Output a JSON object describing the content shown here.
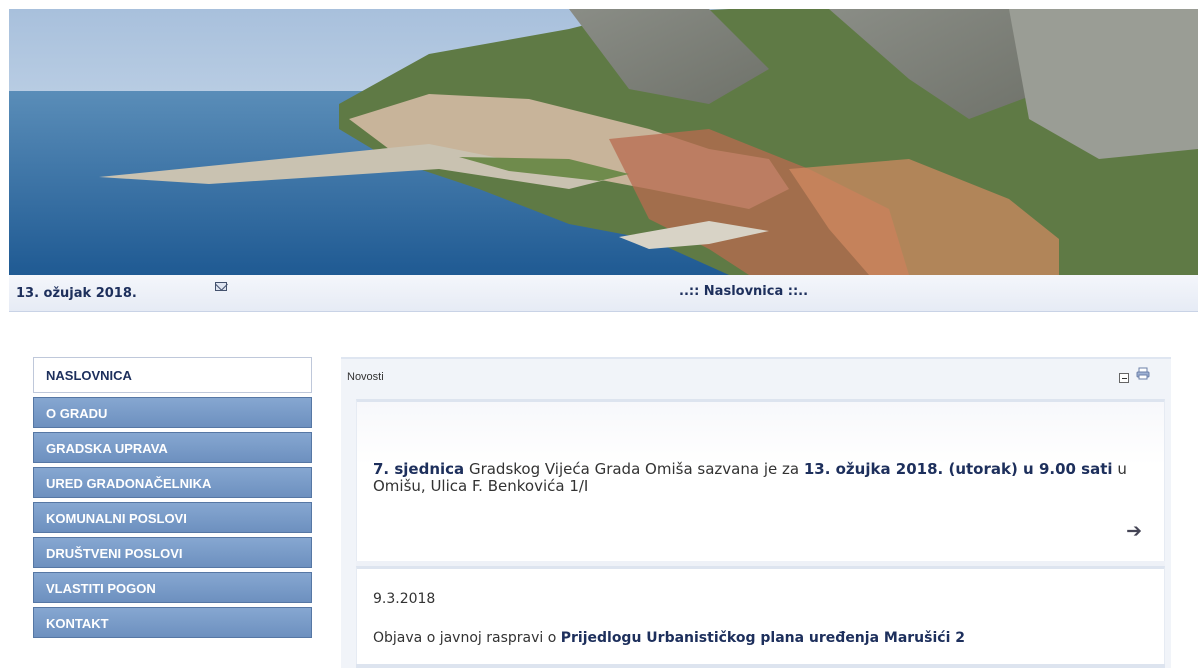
{
  "header": {
    "date": "13. ožujak 2018.",
    "page_heading": "..:: Naslovnica ::.."
  },
  "nav": {
    "items": [
      {
        "label": "NASLOVNICA",
        "active": true
      },
      {
        "label": "O GRADU"
      },
      {
        "label": "GRADSKA UPRAVA"
      },
      {
        "label": "URED GRADONAČELNIKA"
      },
      {
        "label": "KOMUNALNI POSLOVI"
      },
      {
        "label": "DRUŠTVENI POSLOVI"
      },
      {
        "label": "VLASTITI POGON"
      },
      {
        "label": "KONTAKT"
      }
    ]
  },
  "news": {
    "title": "Novosti",
    "card1": {
      "part1": "7. sjednica",
      "part2": " Gradskog Vijeća Grada Omiša sazvana je za ",
      "part3": "13. ožujka 2018. (utorak) u 9.00 sati",
      "part4": " u Omišu, Ulica F. Benkovića 1/I"
    },
    "card2": {
      "date": "9.3.2018",
      "text_prefix": "Objava o javnoj raspravi o ",
      "text_bold": "Prijedlogu Urbanističkog plana uređenja Marušići 2"
    }
  },
  "colors": {
    "nav_bg": "#7a9bc8",
    "nav_text": "#ffffff",
    "heading_text": "#1d2f5c"
  },
  "icons": {
    "mail": "envelope-icon",
    "collapse": "minus-box-icon",
    "print": "print-icon",
    "more": "arrow-right-icon"
  }
}
